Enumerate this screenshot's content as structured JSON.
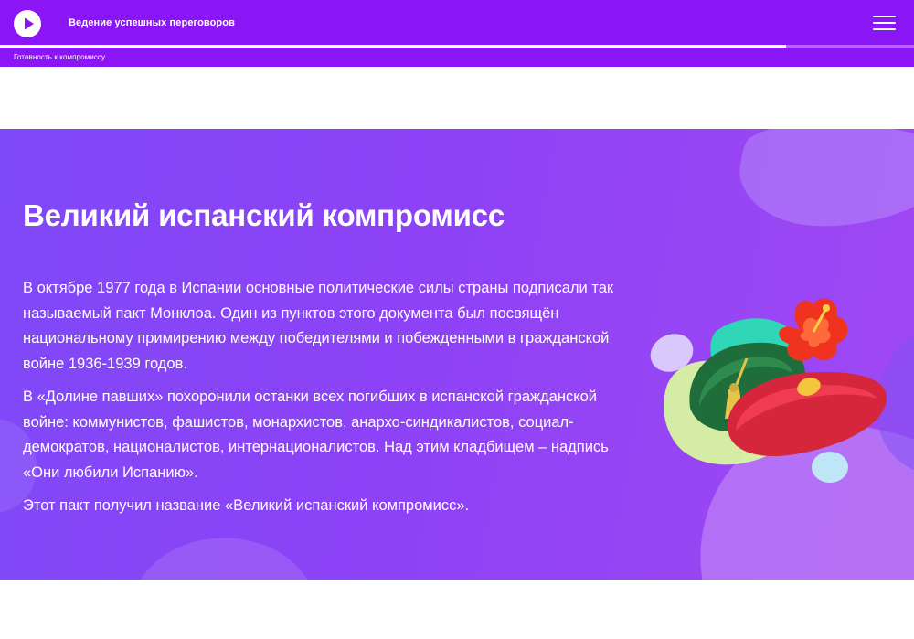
{
  "header": {
    "course_title": "Ведение успешных переговоров",
    "section_label": "Готовность к компромиссу",
    "progress": 0.86,
    "play_icon": "play-icon",
    "menu_icon": "hamburger-menu-icon",
    "accent_color": "#8b16f5"
  },
  "content": {
    "title": "Великий испанский компромисс",
    "paragraphs": [
      "В октябре 1977 года в Испании основные политические силы страны подписали так называемый пакт Монклоа. Один из пунктов этого документа был посвящён национальному примирению между победителями и побежденными в гражданской войне 1936-1939 годов.",
      "В «Долине павших» похоронили останки всех погибших в испанской гражданской войне: коммунистов, фашистов, монархистов, анархо-синдикалистов, социал-демократов, националистов, интернационалистов. Над этим кладбищем – надпись «Они любили Испанию».",
      "Этот пакт получил название «Великий испанский компромисс»."
    ],
    "background_color": "#8d42f6"
  }
}
